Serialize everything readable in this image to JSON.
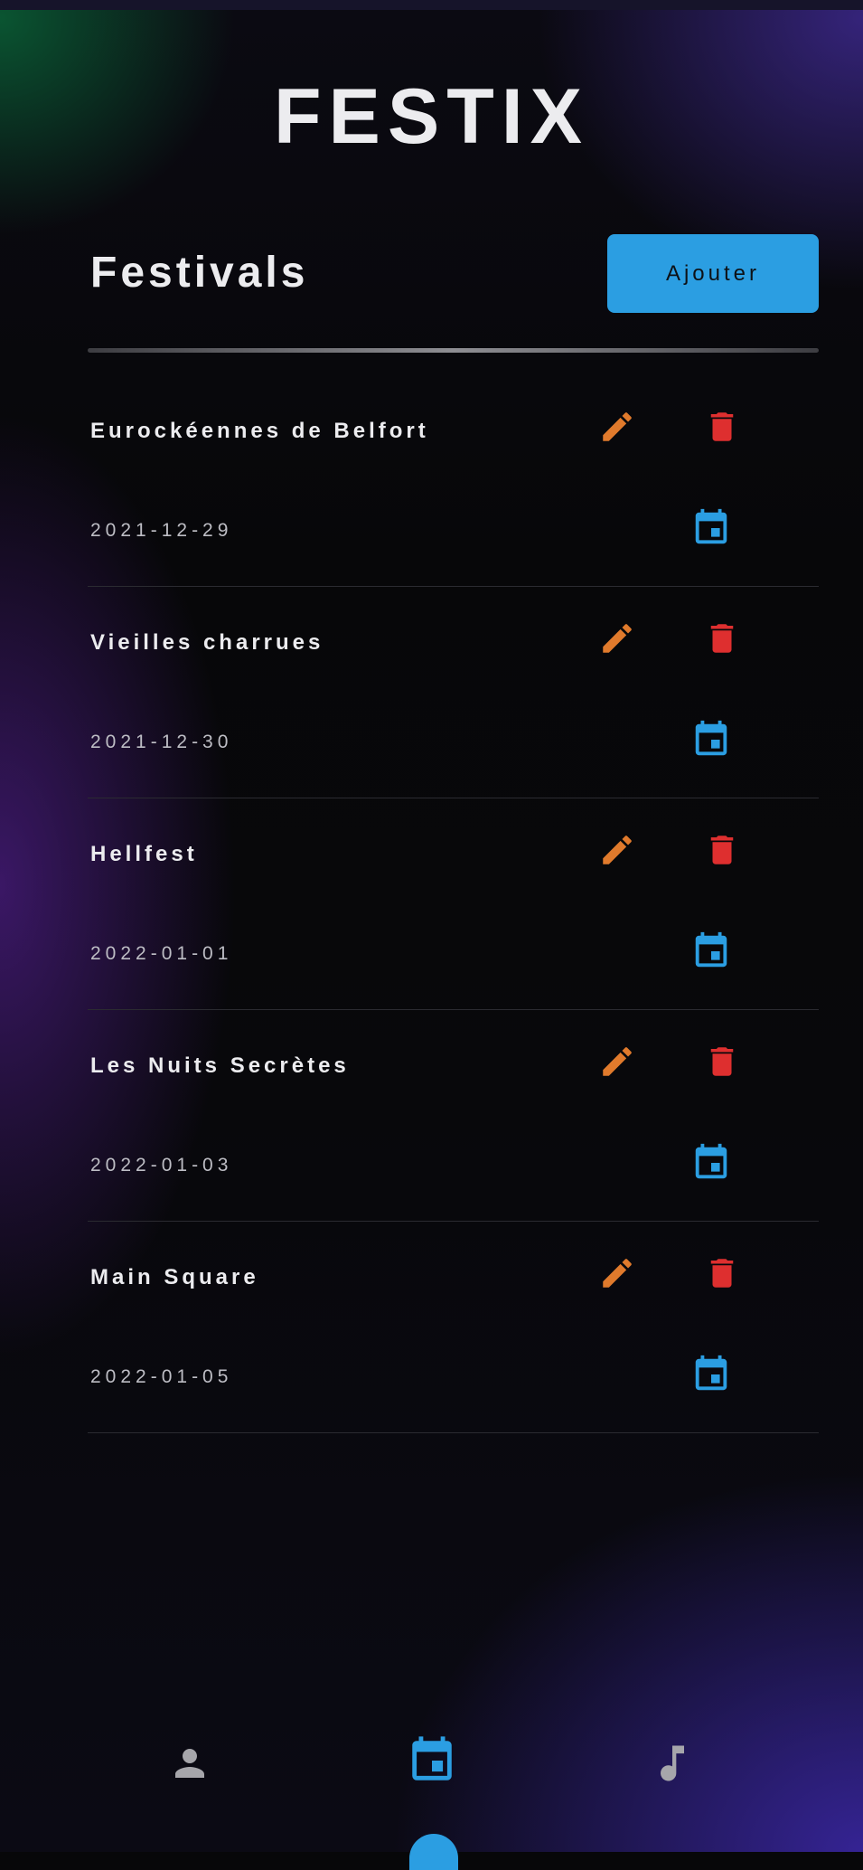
{
  "app": {
    "title": "FESTIX"
  },
  "header": {
    "section_title": "Festivals",
    "add_label": "Ajouter"
  },
  "colors": {
    "accent": "#2b9ee2",
    "edit": "#e07a2c",
    "delete": "#de2f2f",
    "nav_inactive": "#a6a6ab"
  },
  "icons": {
    "edit": "pencil-icon",
    "delete": "trash-icon",
    "date": "calendar-icon",
    "nav_profile": "person-icon",
    "nav_festivals": "calendar-icon",
    "nav_music": "music-note-icon"
  },
  "festivals": [
    {
      "name": "Eurockéennes de Belfort",
      "date": "2021-12-29"
    },
    {
      "name": "Vieilles charrues",
      "date": "2021-12-30"
    },
    {
      "name": "Hellfest",
      "date": "2022-01-01"
    },
    {
      "name": "Les Nuits Secrètes",
      "date": "2022-01-03"
    },
    {
      "name": "Main Square",
      "date": "2022-01-05"
    }
  ],
  "bottom_nav": {
    "active": "festivals"
  }
}
